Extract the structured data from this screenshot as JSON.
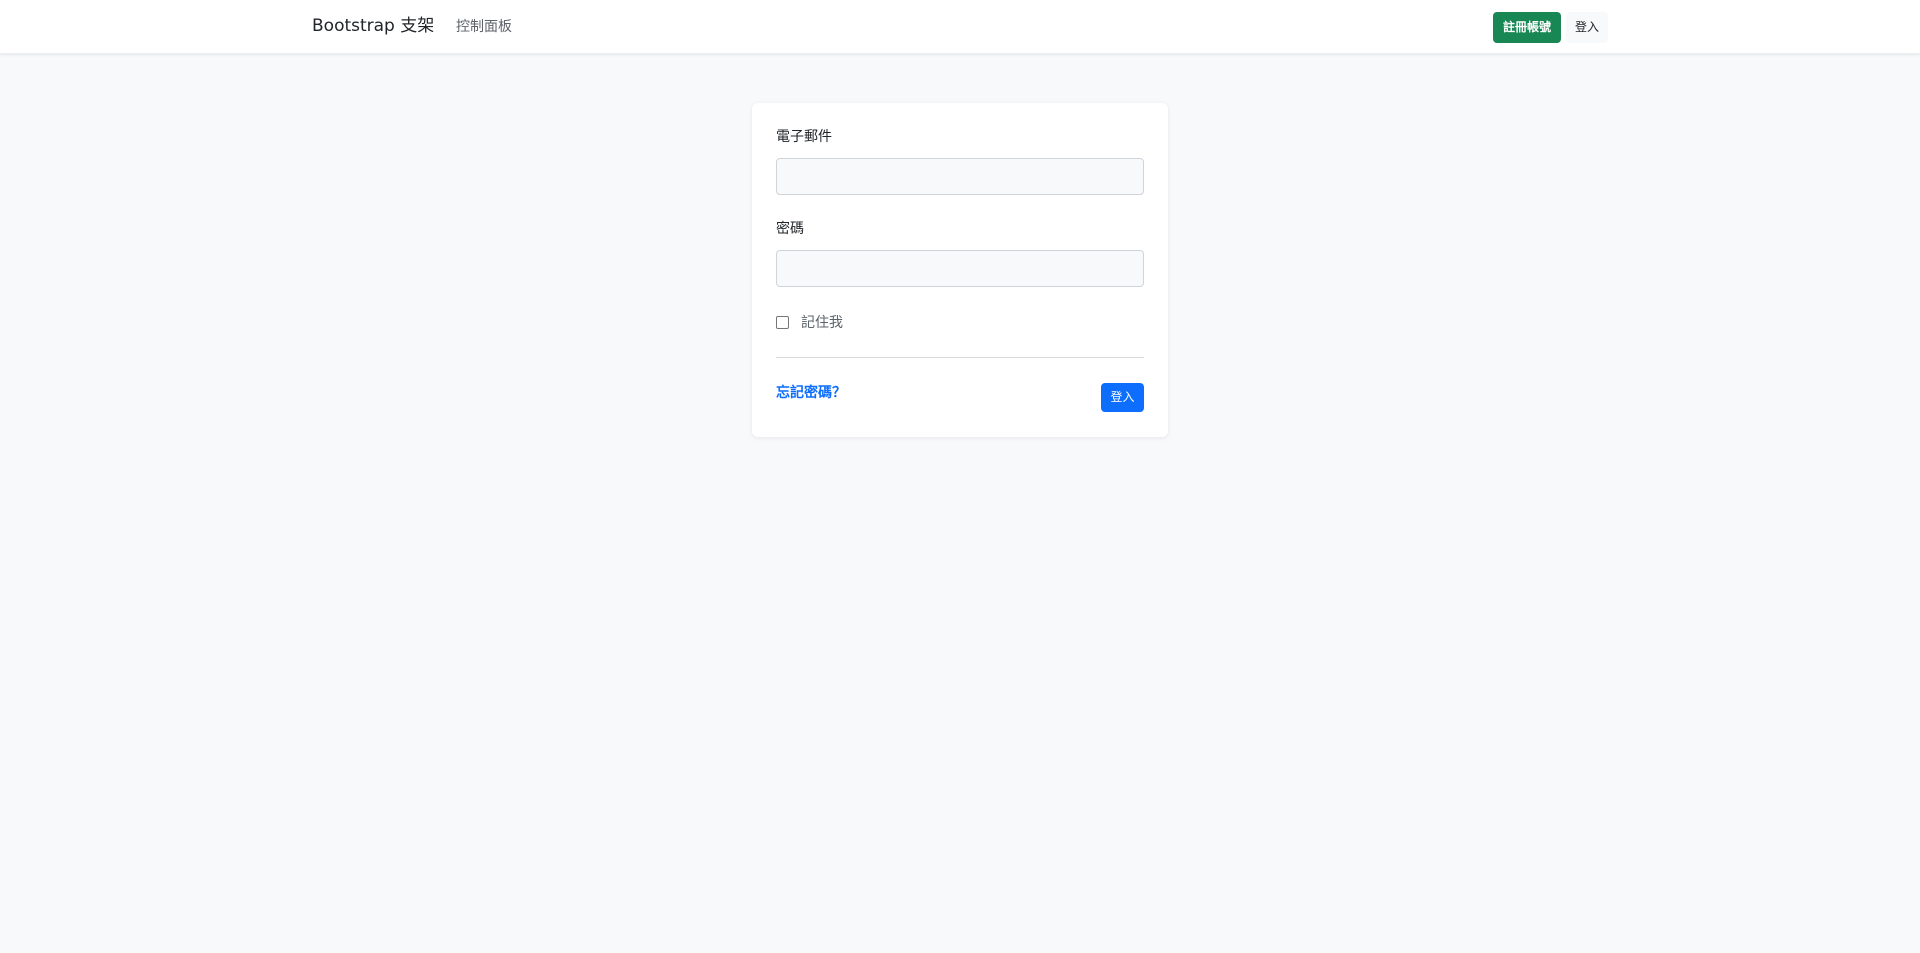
{
  "navbar": {
    "brand": "Bootstrap 支架",
    "links": [
      {
        "label": "控制面板"
      }
    ],
    "register_label": "註冊帳號",
    "login_label": "登入"
  },
  "form": {
    "email_label": "電子郵件",
    "email_value": "",
    "password_label": "密碼",
    "password_value": "",
    "remember_label": "記住我",
    "remember_checked": false,
    "forgot_label": "忘記密碼？",
    "submit_label": "登入"
  },
  "colors": {
    "page_bg": "#f8f9fa",
    "primary": "#0d6efd",
    "success": "#198754"
  }
}
